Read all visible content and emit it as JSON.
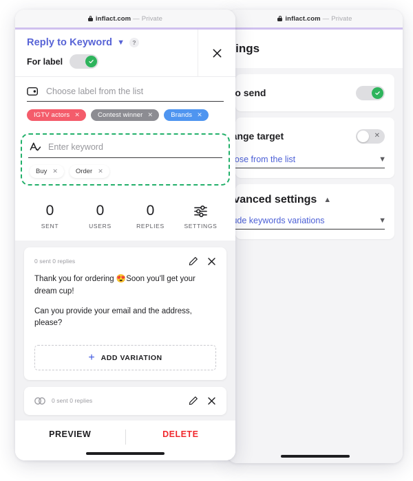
{
  "colors": {
    "accent_rule": "#cfc0ee",
    "link_blue": "#5763d6",
    "toggle_on_green": "#2eb45c",
    "highlight_dashed_green": "#22b06a",
    "delete_red": "#f0282d",
    "chip_red": "#f45c6b",
    "chip_gray": "#8c8c92",
    "chip_blue": "#4f95f0",
    "plus_blue": "#3b55e0"
  },
  "foreground_window": {
    "address_bar": {
      "host": "inflact.com",
      "separator": "—",
      "mode": "Private"
    },
    "header": {
      "title": "Reply to Keyword",
      "help_glyph": "?",
      "for_label": "For label"
    },
    "label_field": {
      "placeholder": "Choose label from the list",
      "chips": [
        {
          "text": "IGTV actors"
        },
        {
          "text": "Contest winner"
        },
        {
          "text": "Brands"
        }
      ]
    },
    "keyword_field": {
      "placeholder": "Enter keyword",
      "chips": [
        {
          "text": "Buy"
        },
        {
          "text": "Order"
        }
      ]
    },
    "stats": [
      {
        "value": "0",
        "label": "SENT"
      },
      {
        "value": "0",
        "label": "USERS"
      },
      {
        "value": "0",
        "label": "REPLIES"
      },
      {
        "value": "",
        "label": "SETTINGS"
      }
    ],
    "variations": [
      {
        "meta": "0 sent  0 replies",
        "paragraphs": [
          "Thank you for ordering 😍Soon you'll get your dream cup!",
          "Can you provide your email and the address, please?"
        ]
      },
      {
        "meta": "0 sent  0 replies",
        "paragraphs": []
      }
    ],
    "add_variation_label": "ADD VARIATION",
    "footer": {
      "preview": "PREVIEW",
      "delete": "DELETE"
    }
  },
  "background_window": {
    "address_bar": {
      "host": "inflact.com",
      "separator": "—",
      "mode": "Private"
    },
    "title": "Settings",
    "rows": [
      {
        "label": "Auto send",
        "toggle": "on"
      },
      {
        "label": "Change target",
        "toggle": "off",
        "select_value": "Choose from the list"
      }
    ],
    "section": {
      "title": "Advanced settings",
      "collapsed": false,
      "select_value": "Include keywords variations"
    }
  }
}
